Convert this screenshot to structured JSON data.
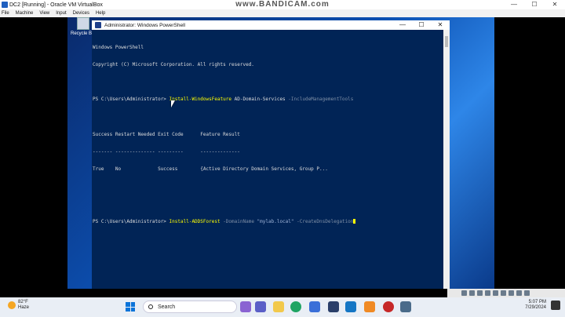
{
  "host": {
    "title": "DC2 [Running] - Oracle VM VirtualBox",
    "watermark": "www.BANDICAM.com",
    "menu": [
      "File",
      "Machine",
      "View",
      "Input",
      "Devices",
      "Help"
    ],
    "controls": [
      "—",
      "☐",
      "✕"
    ]
  },
  "desktop": {
    "recycle_bin_label": "Recycle Bin"
  },
  "powershell": {
    "title": "Administrator: Windows PowerShell",
    "controls": [
      "—",
      "☐",
      "✕"
    ],
    "lines": {
      "l1": "Windows PowerShell",
      "l2": "Copyright (C) Microsoft Corporation. All rights reserved.",
      "prompt1": "PS C:\\Users\\Administrator> ",
      "cmd1": "Install-WindowsFeature",
      "arg1": " AD-Domain-Services ",
      "param1": "-IncludeManagementTools",
      "hdr": "Success Restart Needed Exit Code      Feature Result",
      "sep": "------- -------------- ---------      --------------",
      "row": "True    No             Success        {Active Directory Domain Services, Group P...",
      "prompt2": "PS C:\\Users\\Administrator> ",
      "cmd2": "Install-ADDSForest",
      "param2a": " -DomainName ",
      "str2": "\"mylab.local\"",
      "param2b": " -CreateDnsDelegation"
    }
  },
  "taskbar": {
    "weather_temp": "82°F",
    "weather_desc": "Haze",
    "search_label": "Search",
    "time": "5:07 PM",
    "date": "7/29/2024"
  }
}
